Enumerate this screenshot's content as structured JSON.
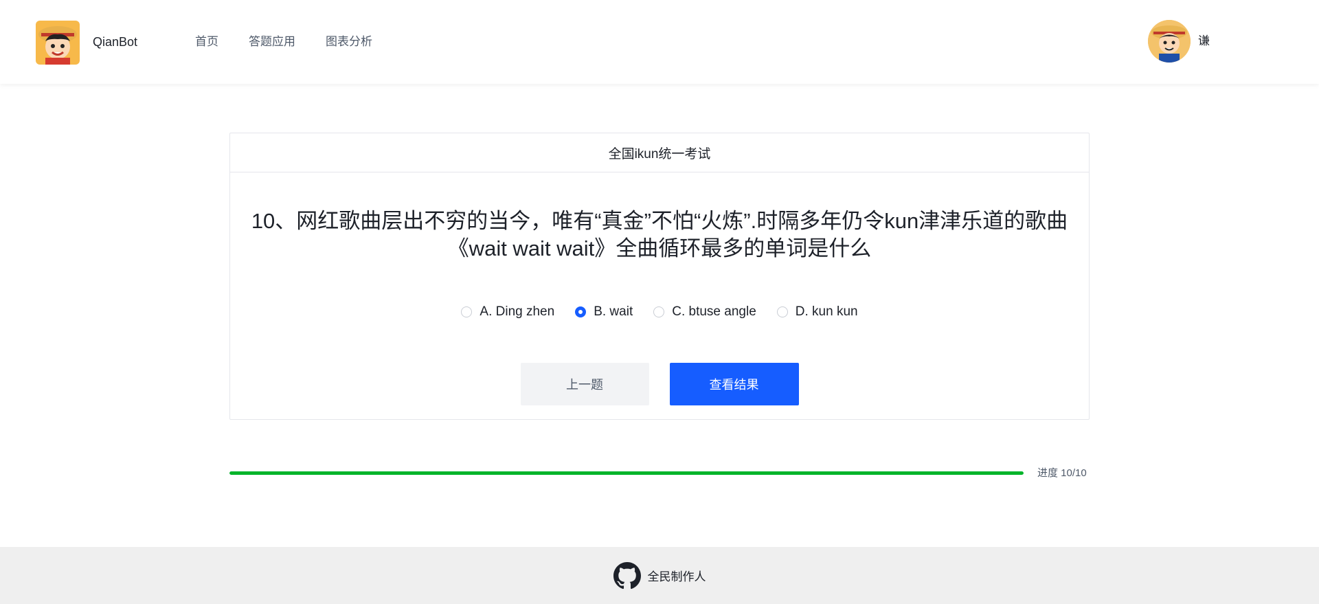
{
  "header": {
    "brand": "QianBot",
    "logo_icon": "luffy-logo-icon",
    "nav": [
      {
        "label": "首页"
      },
      {
        "label": "答题应用"
      },
      {
        "label": "图表分析"
      }
    ],
    "avatar_icon": "user-avatar-icon",
    "username": "谦"
  },
  "exam": {
    "title": "全国ikun统一考试",
    "question": "10、网红歌曲层出不穷的当今，唯有“真金”不怕“火炼”.时隔多年仍令kun津津乐道的歌曲《wait wait wait》全曲循环最多的单词是什么",
    "options": [
      {
        "label": "A. Ding zhen",
        "checked": false
      },
      {
        "label": "B. wait",
        "checked": true
      },
      {
        "label": "C. btuse angle",
        "checked": false
      },
      {
        "label": "D. kun kun",
        "checked": false
      }
    ],
    "prev_label": "上一题",
    "result_label": "查看结果"
  },
  "progress": {
    "current": 10,
    "total": 10,
    "text": "进度 10/10",
    "color": "#00b42a"
  },
  "footer": {
    "icon": "github-icon",
    "text": "全民制作人"
  },
  "colors": {
    "primary": "#165dff",
    "success": "#00b42a"
  }
}
